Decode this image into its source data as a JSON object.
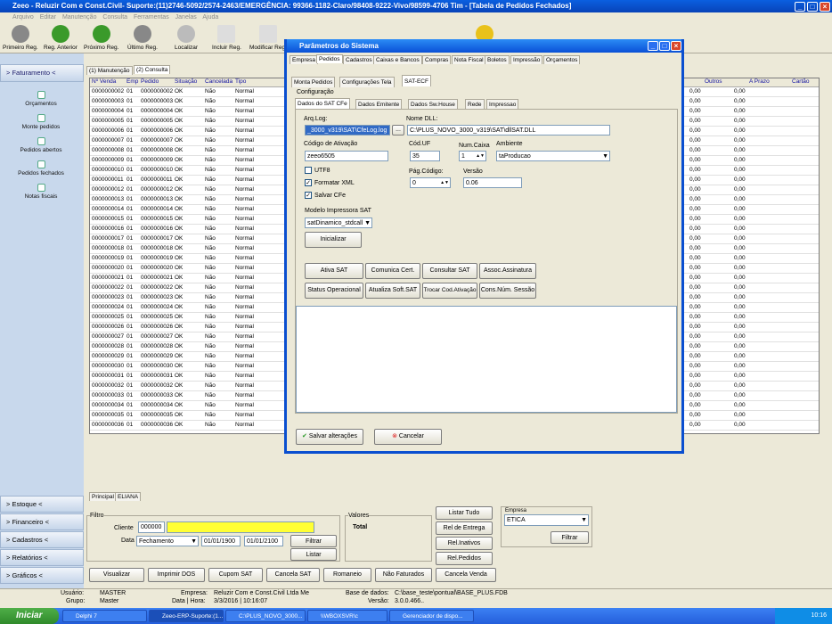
{
  "window": {
    "title": "Zeeo - Reluzir Com e Const.Civil- Suporte:(11)2746-5092/2574-2463/EMERGÊNCIA: 99366-1182-Claro/98408-9222-Vivo/98599-4706 Tim - [Tabela de Pedidos Fechados]"
  },
  "menu": [
    "Arquivo",
    "Editar",
    "Manutenção",
    "Consulta",
    "Ferramentas",
    "Janelas",
    "Ajuda"
  ],
  "toolbar": [
    {
      "label": "Primeiro Reg.",
      "icon": "first-icon"
    },
    {
      "label": "Reg. Anterior",
      "icon": "prev-icon"
    },
    {
      "label": "Próximo Reg.",
      "icon": "next-icon"
    },
    {
      "label": "Último Reg.",
      "icon": "last-icon"
    },
    {
      "label": "Localizar",
      "icon": "search-icon"
    },
    {
      "label": "Incluir Reg.",
      "icon": "add-icon"
    },
    {
      "label": "Modificar Reg.",
      "icon": "edit-icon"
    }
  ],
  "sidebar": {
    "header": "> Faturamento <",
    "items": [
      "Orçamentos",
      "Monte pedidos",
      "Pedidos abertos",
      "Pedidos fechados",
      "Notas fiscais"
    ],
    "bottom": [
      "> Estoque <",
      "> Financeiro <",
      "> Cadastros <",
      "> Relatórios <",
      "> Gráficos <"
    ]
  },
  "main_tabs": [
    "(1) Manutenção",
    "(2) Consulta"
  ],
  "grid": {
    "columns": [
      "Nº Venda",
      "Emp",
      "Pedido",
      "Situação",
      "Cancelada",
      "Tipo"
    ],
    "right_columns": [
      "Outros",
      "A Prazo",
      "Cartão"
    ],
    "rows": [
      [
        "0000000002",
        "01",
        "0000000002",
        "OK",
        "Não",
        "Normal",
        "0,00",
        "0,00"
      ],
      [
        "0000000003",
        "01",
        "0000000003",
        "OK",
        "Não",
        "Normal",
        "0,00",
        "0,00"
      ],
      [
        "0000000004",
        "01",
        "0000000004",
        "OK",
        "Não",
        "Normal",
        "0,00",
        "0,00"
      ],
      [
        "0000000005",
        "01",
        "0000000005",
        "OK",
        "Não",
        "Normal",
        "0,00",
        "0,00"
      ],
      [
        "0000000006",
        "01",
        "0000000006",
        "OK",
        "Não",
        "Normal",
        "0,00",
        "0,00"
      ],
      [
        "0000000007",
        "01",
        "0000000007",
        "OK",
        "Não",
        "Normal",
        "0,00",
        "0,00"
      ],
      [
        "0000000008",
        "01",
        "0000000008",
        "OK",
        "Não",
        "Normal",
        "0,00",
        "0,00"
      ],
      [
        "0000000009",
        "01",
        "0000000009",
        "OK",
        "Não",
        "Normal",
        "0,00",
        "0,00"
      ],
      [
        "0000000010",
        "01",
        "0000000010",
        "OK",
        "Não",
        "Normal",
        "0,00",
        "0,00"
      ],
      [
        "0000000011",
        "01",
        "0000000011",
        "OK",
        "Não",
        "Normal",
        "0,00",
        "0,00"
      ],
      [
        "0000000012",
        "01",
        "0000000012",
        "OK",
        "Não",
        "Normal",
        "0,00",
        "0,00"
      ],
      [
        "0000000013",
        "01",
        "0000000013",
        "OK",
        "Não",
        "Normal",
        "0,00",
        "0,00"
      ],
      [
        "0000000014",
        "01",
        "0000000014",
        "OK",
        "Não",
        "Normal",
        "0,00",
        "0,00"
      ],
      [
        "0000000015",
        "01",
        "0000000015",
        "OK",
        "Não",
        "Normal",
        "0,00",
        "0,00"
      ],
      [
        "0000000016",
        "01",
        "0000000016",
        "OK",
        "Não",
        "Normal",
        "0,00",
        "0,00"
      ],
      [
        "0000000017",
        "01",
        "0000000017",
        "OK",
        "Não",
        "Normal",
        "0,00",
        "0,00"
      ],
      [
        "0000000018",
        "01",
        "0000000018",
        "OK",
        "Não",
        "Normal",
        "0,00",
        "0,00"
      ],
      [
        "0000000019",
        "01",
        "0000000019",
        "OK",
        "Não",
        "Normal",
        "0,00",
        "0,00"
      ],
      [
        "0000000020",
        "01",
        "0000000020",
        "OK",
        "Não",
        "Normal",
        "0,00",
        "0,00"
      ],
      [
        "0000000021",
        "01",
        "0000000021",
        "OK",
        "Não",
        "Normal",
        "0,00",
        "0,00"
      ],
      [
        "0000000022",
        "01",
        "0000000022",
        "OK",
        "Não",
        "Normal",
        "0,00",
        "0,00"
      ],
      [
        "0000000023",
        "01",
        "0000000023",
        "OK",
        "Não",
        "Normal",
        "0,00",
        "0,00"
      ],
      [
        "0000000024",
        "01",
        "0000000024",
        "OK",
        "Não",
        "Normal",
        "0,00",
        "0,00"
      ],
      [
        "0000000025",
        "01",
        "0000000025",
        "OK",
        "Não",
        "Normal",
        "0,00",
        "0,00"
      ],
      [
        "0000000026",
        "01",
        "0000000026",
        "OK",
        "Não",
        "Normal",
        "0,00",
        "0,00"
      ],
      [
        "0000000027",
        "01",
        "0000000027",
        "OK",
        "Não",
        "Normal",
        "0,00",
        "0,00"
      ],
      [
        "0000000028",
        "01",
        "0000000028",
        "OK",
        "Não",
        "Normal",
        "0,00",
        "0,00"
      ],
      [
        "0000000029",
        "01",
        "0000000029",
        "OK",
        "Não",
        "Normal",
        "0,00",
        "0,00"
      ],
      [
        "0000000030",
        "01",
        "0000000030",
        "OK",
        "Não",
        "Normal",
        "0,00",
        "0,00"
      ],
      [
        "0000000031",
        "01",
        "0000000031",
        "OK",
        "Não",
        "Normal",
        "0,00",
        "0,00"
      ],
      [
        "0000000032",
        "01",
        "0000000032",
        "OK",
        "Não",
        "Normal",
        "0,00",
        "0,00"
      ],
      [
        "0000000033",
        "01",
        "0000000033",
        "OK",
        "Não",
        "Normal",
        "0,00",
        "0,00"
      ],
      [
        "0000000034",
        "01",
        "0000000034",
        "OK",
        "Não",
        "Normal",
        "0,00",
        "0,00"
      ],
      [
        "0000000035",
        "01",
        "0000000035",
        "OK",
        "Não",
        "Normal",
        "0,00",
        "0,00"
      ],
      [
        "0000000036",
        "01",
        "0000000036",
        "OK",
        "Não",
        "Normal",
        "0,00",
        "0,00"
      ]
    ]
  },
  "bottom_tabs": [
    "Principal",
    "ELIANA"
  ],
  "filter": {
    "title": "Filtro",
    "cliente_label": "Cliente",
    "cliente_code": "000000",
    "data_label": "Data",
    "data_type": "Fechamento",
    "date_from": "01/01/1900",
    "date_to": "01/01/2100",
    "filtrar": "Filtrar",
    "listar": "Listar"
  },
  "valores": {
    "title": "Valores",
    "total": "Total"
  },
  "right_buttons": [
    "Listar Tudo",
    "Rel de Entrega",
    "Rel.Inativos",
    "Rel.Pedidos"
  ],
  "empresa": {
    "label": "Empresa",
    "value": "ETICA",
    "filtrar": "Filtrar"
  },
  "action_buttons": [
    "Visualizar",
    "Imprimir DOS",
    "Cupom SAT",
    "Cancela SAT",
    "Romaneio",
    "Não Faturados",
    "Cancela Venda"
  ],
  "status": {
    "usuario_label": "Usuário:",
    "usuario": "MASTER",
    "grupo_label": "Grupo:",
    "grupo": "Master",
    "empresa_label": "Empresa:",
    "empresa": "Reluzir Com e Const.Civil Ltda Me",
    "data_label": "Data | Hora:",
    "data": "3/3/2016 | 10:16:07",
    "base_label": "Base de dados:",
    "base": "C:\\base_teste\\pontual\\BASE_PLUS.FDB",
    "versao_label": "Versão:",
    "versao": "3.0.0.466.."
  },
  "taskbar": {
    "start": "Iniciar",
    "tasks": [
      "Delphi 7",
      "Zeeo-ERP-Suporte:(1...",
      "C:\\PLUS_NOVO_3000...",
      "\\\\WBOXSVR\\c",
      "Gerenciador de dispo..."
    ],
    "clock": "10:16"
  },
  "dialog": {
    "title": "Parâmetros do Sistema",
    "tabs": [
      "Empresa",
      "Pedidos",
      "Cadastros",
      "Caixas e Bancos",
      "Compras",
      "Nota Fiscal",
      "Boletos",
      "Impressão",
      "Orçamentos"
    ],
    "subtabs": [
      "Monta Pedidos",
      "Configurações Tela",
      "SAT-ECF"
    ],
    "group": "Configuração",
    "innertabs": [
      "Dados do SAT CFe",
      "Dados Emitente",
      "Dados Sw.House",
      "Rede",
      "Impressao"
    ],
    "arqlog_label": "Arq.Log:",
    "arqlog_value": "_3000_v319\\SAT\\CfeLog.log",
    "browse": "...",
    "nomedll_label": "Nome DLL:",
    "nomedll_value": "C:\\PLUS_NOVO_3000_v319\\SAT\\dllSAT.DLL",
    "codativ_label": "Código de Ativação",
    "codativ_value": "zeeo6505",
    "coduf_label": "Cód.UF",
    "coduf_value": "35",
    "numcaixa_label": "Num.Caixa",
    "numcaixa_value": "1",
    "ambiente_label": "Ambiente",
    "ambiente_value": "taProducao",
    "utf8": "UTF8",
    "formatar": "Formatar XML",
    "salvar": "Salvar CFe",
    "pagcodigo_label": "Pág.Código:",
    "pagcodigo_value": "0",
    "versao_label": "Versão",
    "versao_value": "0.06",
    "modelo_label": "Modelo Impressora SAT",
    "modelo_value": "satDinamico_stdcall",
    "inicializar": "Inicializar",
    "buttons_row1": [
      "Ativa SAT",
      "Comunica Cert.",
      "Consultar SAT",
      "Assoc.Assinatura"
    ],
    "buttons_row2": [
      "Status Operacional",
      "Atualiza Soft.SAT",
      "Trocar Cod.Ativação",
      "Cons.Núm. Sessão"
    ],
    "salvar_btn": "Salvar alterações",
    "cancelar_btn": "Cancelar"
  }
}
